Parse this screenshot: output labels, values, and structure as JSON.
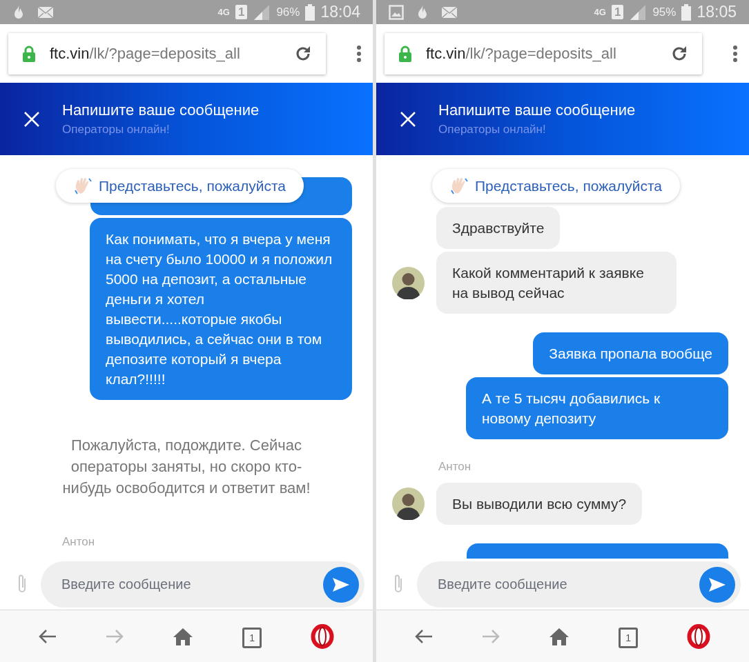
{
  "screens": [
    {
      "status_bar": {
        "notifications": [
          {
            "kind": "flame"
          },
          {
            "kind": "mail"
          }
        ],
        "network": "4G",
        "sim": "1",
        "battery": "96%",
        "time": "18:04"
      },
      "address_bar": {
        "host": "ftc.vin",
        "path": "/lk/?page=deposits_all"
      },
      "chat_header": {
        "title": "Напишите ваше сообщение",
        "subtitle": "Операторы онлайн!"
      },
      "intro_chip": "Представьтесь, пожалуйста",
      "messages": [
        {
          "kind": "clipped_outgoing"
        },
        {
          "kind": "outgoing",
          "text": "Как понимать, что я вчера у меня на счету было 10000 и я положил 5000 на депозит, а остальные деньги я хотел вывести.....которые якобы выводились, а сейчас они в том депозите который я вчера клал?!!!!!"
        },
        {
          "kind": "system",
          "text": "Пожалуйста, подождите. Сейчас операторы заняты, но скоро кто-нибудь освободится и ответит вам!"
        },
        {
          "kind": "sender",
          "text": "Антон"
        }
      ],
      "composer": {
        "placeholder": "Введите сообщение"
      },
      "nav": {
        "tab_count": "1"
      }
    },
    {
      "status_bar": {
        "notifications": [
          {
            "kind": "image"
          },
          {
            "kind": "flame"
          },
          {
            "kind": "mail"
          }
        ],
        "network": "4G",
        "sim": "1",
        "battery": "95%",
        "time": "18:05"
      },
      "address_bar": {
        "host": "ftc.vin",
        "path": "/lk/?page=deposits_all"
      },
      "chat_header": {
        "title": "Напишите ваше сообщение",
        "subtitle": "Операторы онлайн!"
      },
      "intro_chip": "Представьтесь, пожалуйста",
      "messages": [
        {
          "kind": "incoming",
          "text": "Здравствуйте",
          "avatar": false
        },
        {
          "kind": "incoming",
          "text": "Какой комментарий к заявке на вывод сейчас",
          "avatar": true
        },
        {
          "kind": "outgoing",
          "text": "Заявка пропала вообще"
        },
        {
          "kind": "outgoing",
          "text": "А те 5 тысяч добавились к новому депозиту"
        },
        {
          "kind": "sender",
          "text": "Антон"
        },
        {
          "kind": "incoming",
          "text": "Вы выводили всю сумму?",
          "avatar": true
        },
        {
          "kind": "clipped_outgoing"
        }
      ],
      "composer": {
        "placeholder": "Введите сообщение"
      },
      "nav": {
        "tab_count": "1"
      }
    }
  ]
}
